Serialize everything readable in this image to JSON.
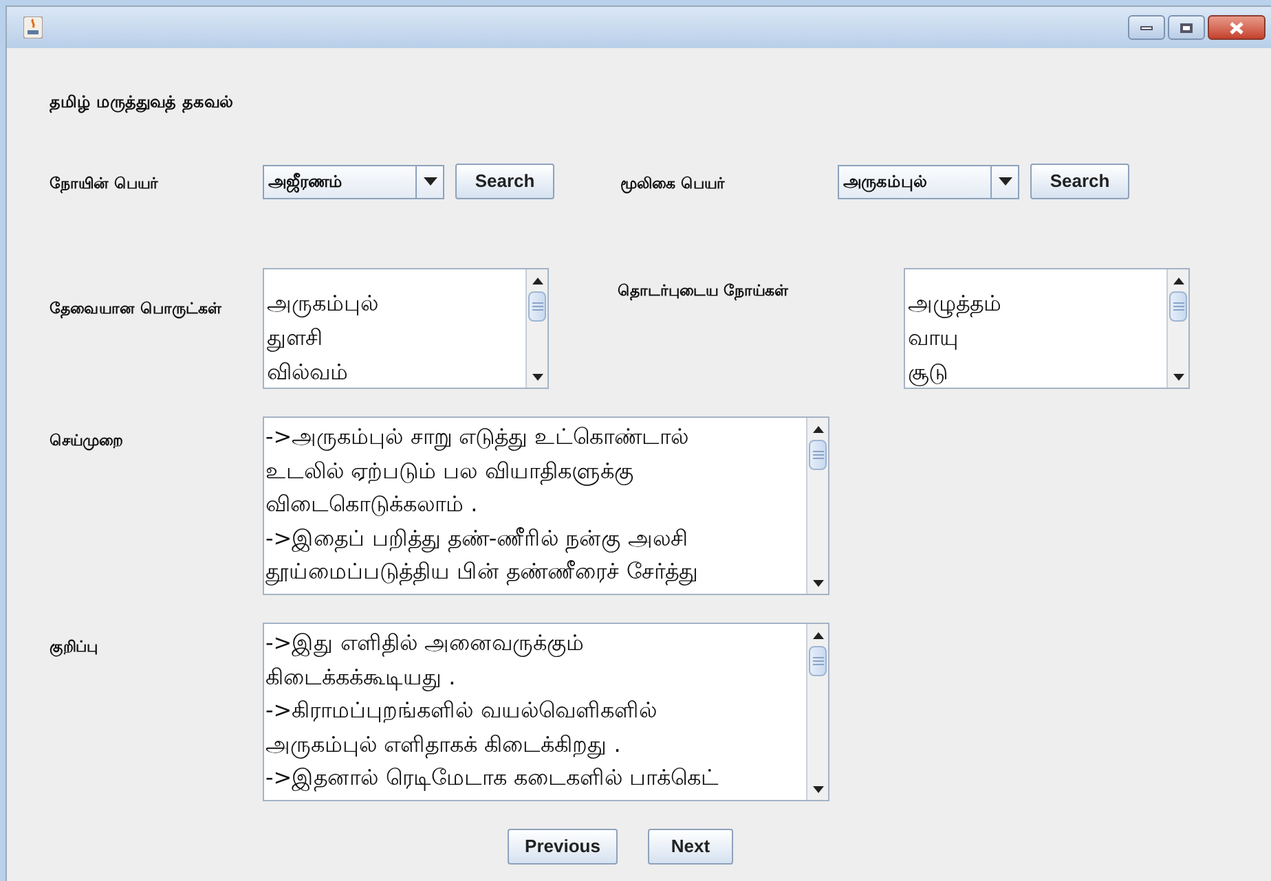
{
  "heading": "தமிழ் மருத்துவத் தகவல்",
  "disease": {
    "label": "நோயின் பெயர்",
    "value": "அஜீரணம்",
    "button": "Search"
  },
  "herb": {
    "label": "மூலிகை பெயர்",
    "value": "அருகம்புல்",
    "button": "Search"
  },
  "ingredients": {
    "label": "தேவையான பொருட்கள்",
    "items": [
      "அருகம்புல்",
      "துளசி",
      "வில்வம்"
    ]
  },
  "related_diseases": {
    "label": "தொடர்புடைய நோய்கள்",
    "items": [
      "அழுத்தம்",
      "வாயு",
      "சூடு"
    ]
  },
  "method": {
    "label": "செய்முறை",
    "lines": [
      "->அருகம்புல் சாறு எடுத்து உட்கொண்டால்",
      "உடலில் ஏற்படும் பல வியாதிகளுக்கு",
      "விடைகொடுக்கலாம் .",
      "->இதைப் பறித்து தண்-ணீரில் நன்கு அலசி",
      "தூய்மைப்படுத்திய பின் தண்ணீரைச் சேர்த்து"
    ]
  },
  "note": {
    "label": "குறிப்பு",
    "lines": [
      "->இது எளிதில் அனைவருக்கும்",
      "கிடைக்கக்கூடியது .",
      "->கிராமப்புறங்களில் வயல்வெளிகளில்",
      "அருகம்புல் எளிதாகக் கிடைக்கிறது .",
      "->இதனால் ரெடிமேடாக கடைகளில் பாக்கெட்"
    ]
  },
  "buttons": [
    "Previous",
    "Next"
  ]
}
